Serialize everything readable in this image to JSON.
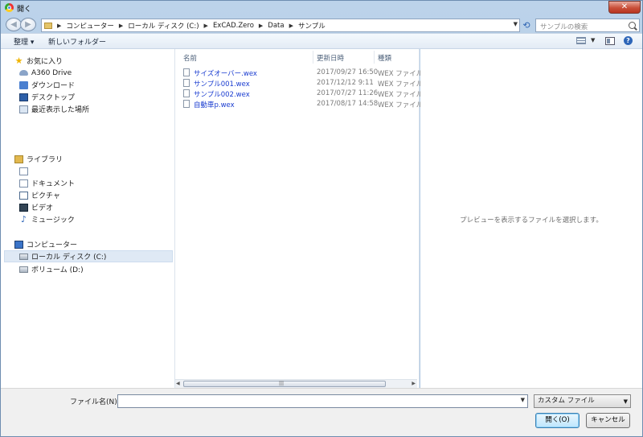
{
  "window": {
    "title": "開く"
  },
  "navigation": {
    "back_icon": "back-arrow-icon",
    "forward_icon": "forward-arrow-icon",
    "breadcrumb": [
      "コンピューター",
      "ローカル ディスク (C:)",
      "ExCAD.Zero",
      "Data",
      "サンプル"
    ],
    "search_placeholder": "サンプルの検索"
  },
  "toolbar": {
    "organize": "整理 ▾",
    "new_folder": "新しいフォルダー",
    "help": "?"
  },
  "sidebar": {
    "favorites": {
      "label": "お気に入り",
      "items": [
        {
          "label": "A360 Drive",
          "icon": "cloud-icon"
        },
        {
          "label": "ダウンロード",
          "icon": "download-icon"
        },
        {
          "label": "デスクトップ",
          "icon": "desktop-icon"
        },
        {
          "label": "最近表示した場所",
          "icon": "recent-places-icon"
        }
      ]
    },
    "libraries": {
      "label": "ライブラリ",
      "items": [
        {
          "label": "",
          "icon": "document-icon"
        },
        {
          "label": "ドキュメント",
          "icon": "document-icon"
        },
        {
          "label": "ピクチャ",
          "icon": "picture-icon"
        },
        {
          "label": "ビデオ",
          "icon": "video-icon"
        },
        {
          "label": "ミュージック",
          "icon": "music-icon"
        }
      ]
    },
    "computer": {
      "label": "コンピューター",
      "items": [
        {
          "label": "ローカル ディスク (C:)",
          "icon": "local-disk-icon",
          "selected": true
        },
        {
          "label": "ボリューム (D:)",
          "icon": "drive-icon"
        }
      ]
    }
  },
  "file_list": {
    "columns": {
      "name": "名前",
      "date": "更新日時",
      "type": "種類"
    },
    "rows": [
      {
        "name": "サイズオーバー.wex",
        "date": "2017/09/27 16:50",
        "type": "WEX ファイル"
      },
      {
        "name": "サンプル001.wex",
        "date": "2017/12/12 9:11",
        "type": "WEX ファイル"
      },
      {
        "name": "サンプル002.wex",
        "date": "2017/07/27 11:26",
        "type": "WEX ファイル"
      },
      {
        "name": "自動車p.wex",
        "date": "2017/08/17 14:58",
        "type": "WEX ファイル"
      }
    ]
  },
  "preview": {
    "message": "プレビューを表示するファイルを選択します。"
  },
  "footer": {
    "filename_label": "ファイル名(N):",
    "filename_value": "",
    "file_type": "カスタム ファイル",
    "open_label": "開く(O)",
    "cancel_label": "キャンセル"
  }
}
